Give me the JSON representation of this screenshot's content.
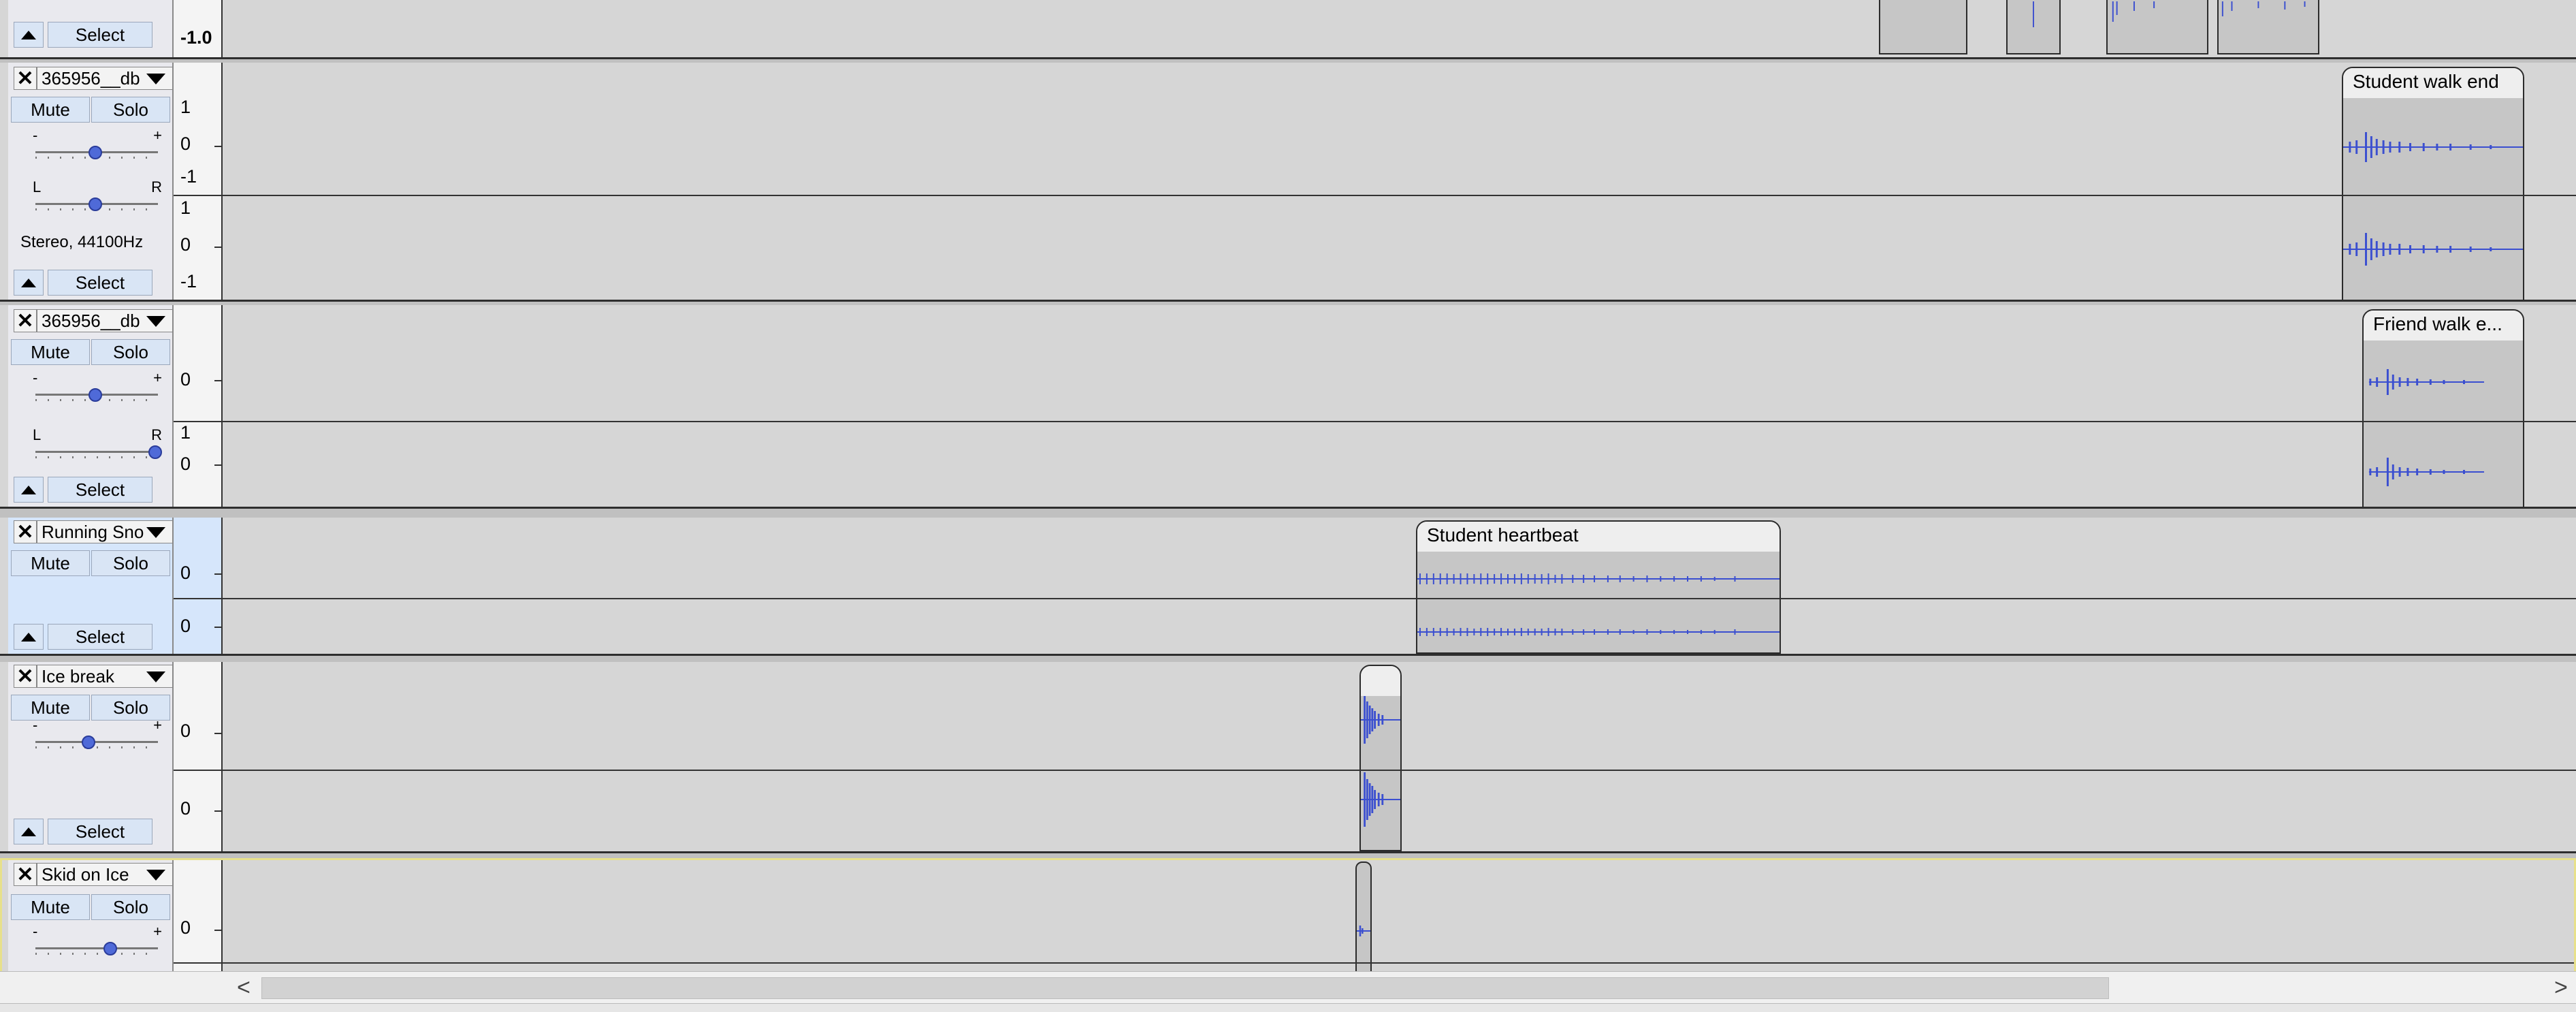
{
  "colors": {
    "waveform": "#3b4fd0",
    "selected_border": "#e7e08a",
    "clip_bg": "#c6c6c6"
  },
  "top_partial_track": {
    "select_label": "Select",
    "ruler_label": "-1.0"
  },
  "tracks": [
    {
      "name": "365956__db",
      "mute": "Mute",
      "solo": "Solo",
      "gain_minus": "-",
      "gain_plus": "+",
      "pan_left": "L",
      "pan_right": "R",
      "info": "Stereo, 44100Hz",
      "select": "Select",
      "ruler_ch1": [
        "1",
        "0",
        "-1"
      ],
      "ruler_ch2": [
        "1",
        "0",
        "-1"
      ],
      "clip_name": "Student walk end"
    },
    {
      "name": "365956__db",
      "mute": "Mute",
      "solo": "Solo",
      "gain_minus": "-",
      "gain_plus": "+",
      "pan_left": "L",
      "pan_right": "R",
      "select": "Select",
      "ruler_ch1": [
        "0"
      ],
      "ruler_ch2": [
        "1",
        "0"
      ],
      "clip_name": "Friend walk e..."
    },
    {
      "name": "Running Sno",
      "mute": "Mute",
      "solo": "Solo",
      "select": "Select",
      "ruler_ch1": [
        "0"
      ],
      "ruler_ch2": [
        "0"
      ],
      "clip_name": "Student heartbeat"
    },
    {
      "name": "Ice break",
      "mute": "Mute",
      "solo": "Solo",
      "gain_minus": "-",
      "gain_plus": "+",
      "select": "Select",
      "ruler_ch1": [
        "0"
      ],
      "ruler_ch2": [
        "0"
      ]
    },
    {
      "name": "Skid on Ice",
      "mute": "Mute",
      "solo": "Solo",
      "gain_minus": "-",
      "gain_plus": "+",
      "ruler_ch1": [
        "0"
      ]
    }
  ],
  "scrollbar": {
    "left_arrow": "<",
    "right_arrow": ">"
  }
}
